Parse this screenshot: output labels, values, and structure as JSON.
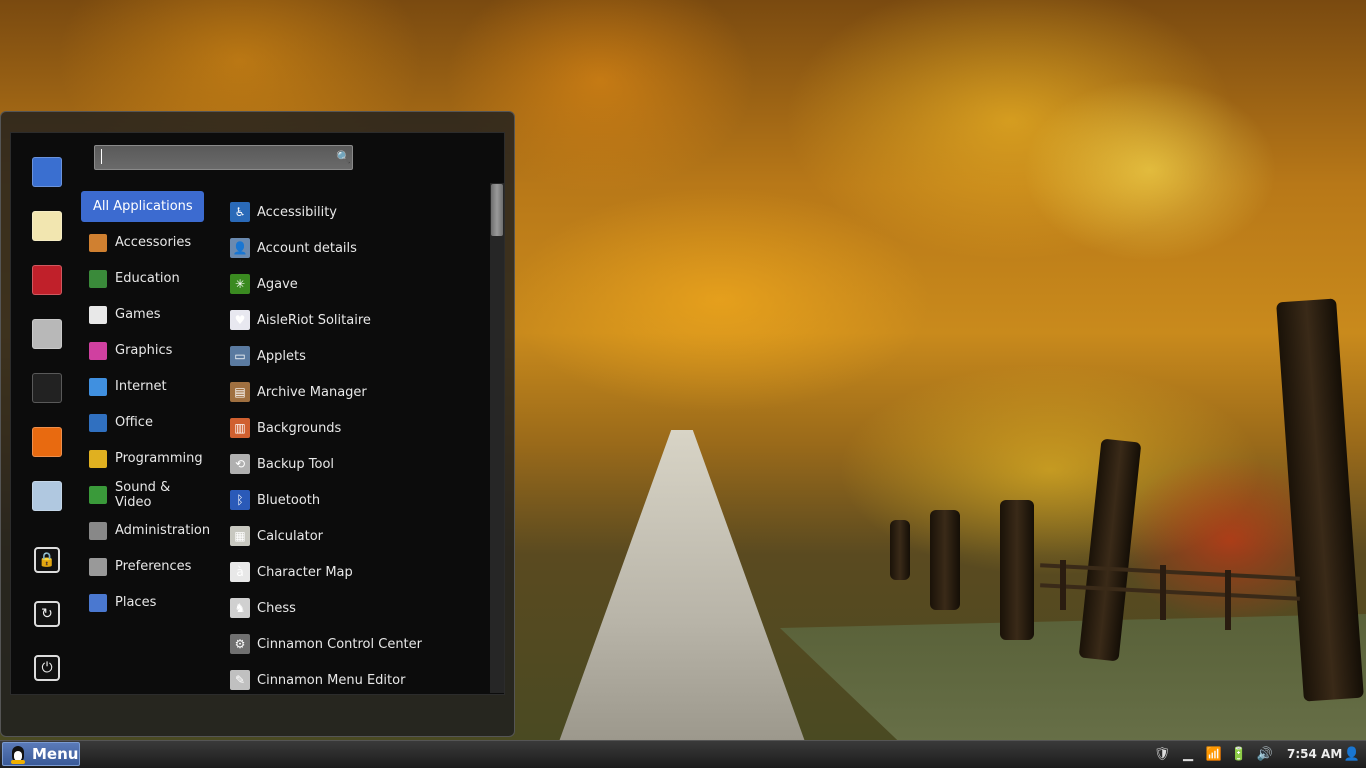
{
  "menu": {
    "search": {
      "value": "",
      "placeholder": ""
    },
    "favorites": [
      {
        "name": "files-icon",
        "color": "#3a6fd0"
      },
      {
        "name": "text-editor-icon",
        "color": "#f2e6b0"
      },
      {
        "name": "book-icon",
        "color": "#c0202a"
      },
      {
        "name": "calculator-icon",
        "color": "#b8b8b8"
      },
      {
        "name": "terminal-icon",
        "color": "#222222"
      },
      {
        "name": "firefox-icon",
        "color": "#e86a10"
      },
      {
        "name": "mail-icon",
        "color": "#b0c8e0"
      }
    ],
    "system_buttons": [
      {
        "name": "lock-screen-icon",
        "glyph": "🔒"
      },
      {
        "name": "logout-icon",
        "glyph": "↻"
      },
      {
        "name": "power-icon",
        "glyph": "⏻"
      }
    ],
    "categories": [
      {
        "label": "All Applications",
        "icon": "all-apps-icon",
        "color": "#3c6bd0"
      },
      {
        "label": "Accessories",
        "icon": "accessories-icon",
        "color": "#d08030"
      },
      {
        "label": "Education",
        "icon": "education-icon",
        "color": "#3a8a3a"
      },
      {
        "label": "Games",
        "icon": "games-icon",
        "color": "#e8e8e8"
      },
      {
        "label": "Graphics",
        "icon": "graphics-icon",
        "color": "#d040a0"
      },
      {
        "label": "Internet",
        "icon": "internet-icon",
        "color": "#4090e0"
      },
      {
        "label": "Office",
        "icon": "office-icon",
        "color": "#3070c0"
      },
      {
        "label": "Programming",
        "icon": "programming-icon",
        "color": "#e0b020"
      },
      {
        "label": "Sound & Video",
        "icon": "sound-video-icon",
        "color": "#3a9a3a"
      },
      {
        "label": "Administration",
        "icon": "administration-icon",
        "color": "#888888"
      },
      {
        "label": "Preferences",
        "icon": "preferences-icon",
        "color": "#999999"
      },
      {
        "label": "Places",
        "icon": "places-icon",
        "color": "#4a78d0"
      }
    ],
    "applications": [
      {
        "label": "Accessibility",
        "icon": "accessibility-icon",
        "color": "#2a6ab8",
        "glyph": "♿"
      },
      {
        "label": "Account details",
        "icon": "account-details-icon",
        "color": "#6a8ab0",
        "glyph": "👤"
      },
      {
        "label": "Agave",
        "icon": "agave-icon",
        "color": "#3a8a20",
        "glyph": "✳"
      },
      {
        "label": "AisleRiot Solitaire",
        "icon": "solitaire-icon",
        "color": "#e8e8f0",
        "glyph": "♥"
      },
      {
        "label": "Applets",
        "icon": "applets-icon",
        "color": "#5a7aa0",
        "glyph": "▭"
      },
      {
        "label": "Archive Manager",
        "icon": "archive-manager-icon",
        "color": "#a07040",
        "glyph": "▤"
      },
      {
        "label": "Backgrounds",
        "icon": "backgrounds-icon",
        "color": "#d06030",
        "glyph": "▥"
      },
      {
        "label": "Backup Tool",
        "icon": "backup-tool-icon",
        "color": "#b0b0b0",
        "glyph": "⟲"
      },
      {
        "label": "Bluetooth",
        "icon": "bluetooth-icon",
        "color": "#2a5ab8",
        "glyph": "ᛒ"
      },
      {
        "label": "Calculator",
        "icon": "calculator-icon",
        "color": "#c8c8c0",
        "glyph": "▦"
      },
      {
        "label": "Character Map",
        "icon": "character-map-icon",
        "color": "#e8e8e8",
        "glyph": "à"
      },
      {
        "label": "Chess",
        "icon": "chess-icon",
        "color": "#d0d0d0",
        "glyph": "♞"
      },
      {
        "label": "Cinnamon Control Center",
        "icon": "cinnamon-control-center-icon",
        "color": "#707070",
        "glyph": "⚙"
      },
      {
        "label": "Cinnamon Menu Editor",
        "icon": "cinnamon-menu-editor-icon",
        "color": "#c0c0c0",
        "glyph": "✎"
      }
    ]
  },
  "panel": {
    "menu_button_label": "Menu",
    "clock": "7:54 AM",
    "tray": [
      {
        "name": "shield-icon",
        "glyph": "🛡"
      },
      {
        "name": "show-desktop-icon",
        "glyph": "▁"
      },
      {
        "name": "wifi-icon",
        "glyph": "📶"
      },
      {
        "name": "battery-icon",
        "glyph": "🔋"
      },
      {
        "name": "volume-icon",
        "glyph": "🔊"
      },
      {
        "name": "user-icon",
        "glyph": "👤"
      }
    ]
  }
}
